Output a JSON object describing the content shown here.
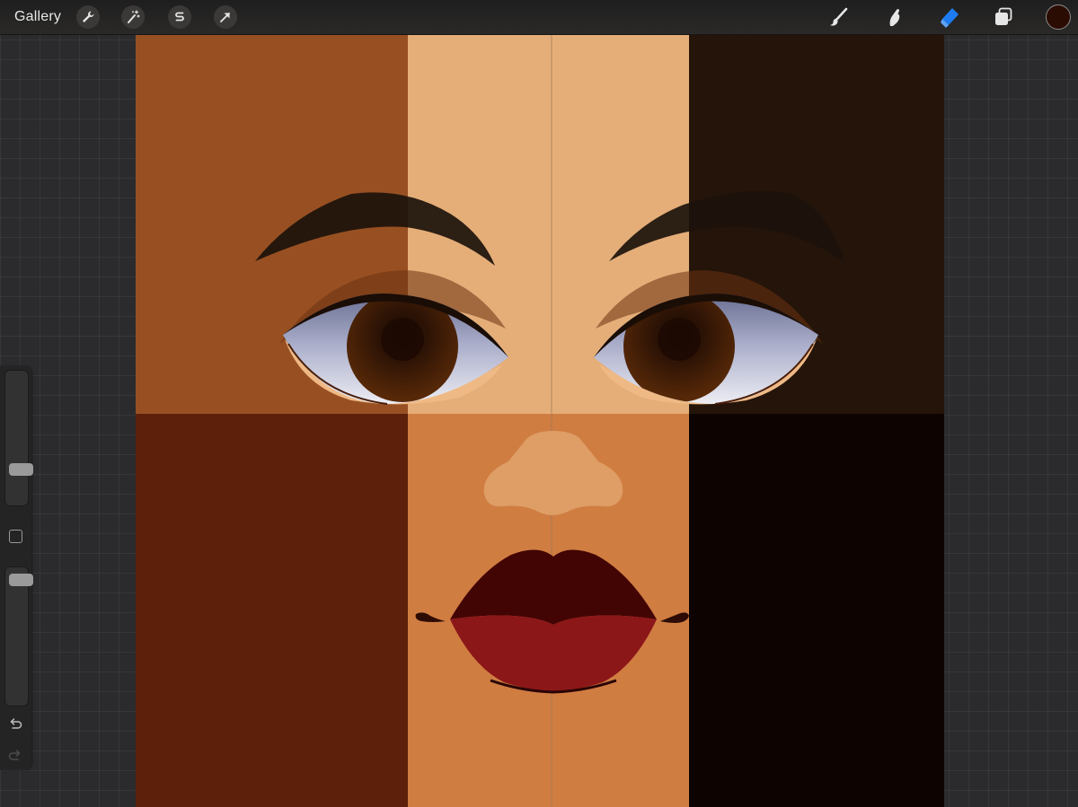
{
  "topbar": {
    "gallery_label": "Gallery",
    "left_tools": [
      {
        "name": "actions",
        "icon": "wrench-icon"
      },
      {
        "name": "adjustments",
        "icon": "magic-wand-icon"
      },
      {
        "name": "selection",
        "icon": "selection-s-icon"
      },
      {
        "name": "transform",
        "icon": "arrow-cursor-icon"
      }
    ],
    "right_tools": [
      {
        "name": "brush",
        "icon": "brush-icon",
        "active": false
      },
      {
        "name": "smudge",
        "icon": "smudge-finger-icon",
        "active": false
      },
      {
        "name": "eraser",
        "icon": "eraser-icon",
        "active": true
      },
      {
        "name": "layers",
        "icon": "layers-icon",
        "active": false
      }
    ],
    "current_color": "#2a0c02",
    "active_color": "#1e7cf2"
  },
  "sidebar": {
    "brush_size_level": 0.24,
    "opacity_level": 0.95,
    "modify_icon": "square-modify-icon",
    "undo_icon": "undo-arrow-icon",
    "redo_icon": "redo-arrow-icon"
  },
  "canvas": {
    "skin_tones_top": [
      "#985022",
      "#e5ae78",
      "#241409"
    ],
    "skin_tones_bottom": [
      "#5d200b",
      "#d07d42",
      "#0d0402"
    ],
    "nose_color": "#de9e65",
    "lip_top_color": "#430404",
    "lip_bottom_color": "#8c1718",
    "iris_color": "#4a2207",
    "brow_color": "#1c120c"
  }
}
